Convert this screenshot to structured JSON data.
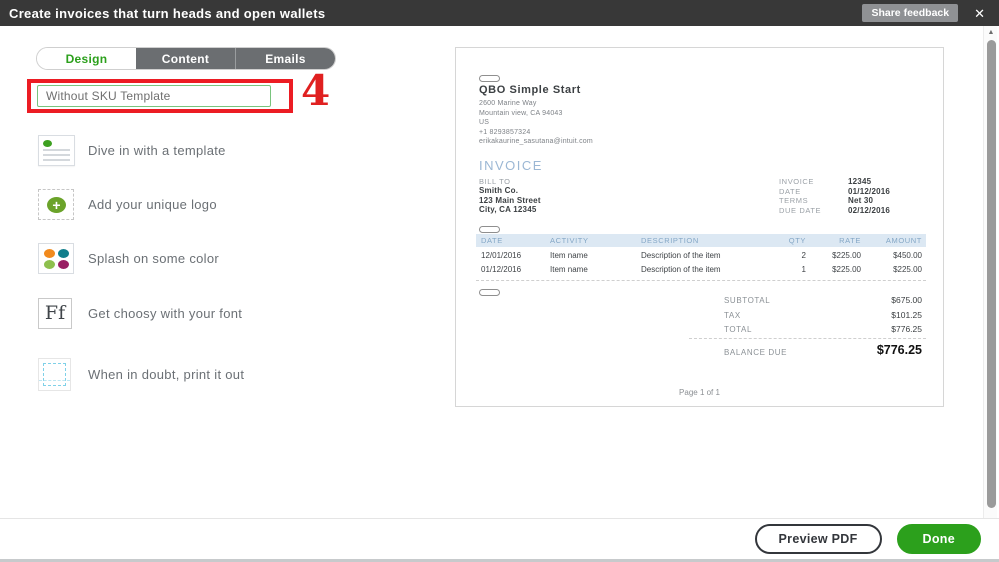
{
  "header": {
    "title": "Create invoices that turn heads and open wallets",
    "share_feedback_label": "Share feedback"
  },
  "icons": {
    "close": "✕",
    "plus": "+",
    "arrow_up": "▲",
    "arrow_down": "▼"
  },
  "tabs": [
    {
      "label": "Design",
      "active": true
    },
    {
      "label": "Content",
      "active": false
    },
    {
      "label": "Emails",
      "active": false
    }
  ],
  "design": {
    "template_name": "Without SKU Template",
    "annotation_number": "4"
  },
  "sidebar": {
    "items": [
      {
        "icon": "template-icon",
        "label": "Dive in with a template"
      },
      {
        "icon": "logo-upload-icon",
        "label": "Add your unique logo"
      },
      {
        "icon": "color-palette-icon",
        "label": "Splash on some color"
      },
      {
        "icon": "font-icon",
        "label": "Get choosy with your font",
        "icon_text": "Ff"
      },
      {
        "icon": "print-icon",
        "label": "When in doubt, print it out"
      }
    ]
  },
  "invoice": {
    "company_name": "QBO Simple Start",
    "company_address": [
      "2600 Marine Way",
      "Mountain view, CA 94043",
      "US",
      "+1 8293857324",
      "erikakaurine_sasutana@intuit.com"
    ],
    "title": "INVOICE",
    "bill_to": {
      "label": "BILL TO",
      "lines": [
        "Smith Co.",
        "123 Main Street",
        "City, CA 12345"
      ]
    },
    "meta": [
      {
        "label": "INVOICE",
        "value": "12345"
      },
      {
        "label": "DATE",
        "value": "01/12/2016"
      },
      {
        "label": "TERMS",
        "value": "Net 30"
      },
      {
        "label": "DUE DATE",
        "value": "02/12/2016"
      }
    ],
    "table": {
      "headers": [
        "DATE",
        "ACTIVITY",
        "DESCRIPTION",
        "QTY",
        "RATE",
        "AMOUNT"
      ],
      "rows": [
        [
          "12/01/2016",
          "Item name",
          "Description of the item",
          "2",
          "$225.00",
          "$450.00"
        ],
        [
          "01/12/2016",
          "Item name",
          "Description of the item",
          "1",
          "$225.00",
          "$225.00"
        ]
      ]
    },
    "totals": [
      {
        "label": "SUBTOTAL",
        "value": "$675.00"
      },
      {
        "label": "TAX",
        "value": "$101.25"
      },
      {
        "label": "TOTAL",
        "value": "$776.25"
      }
    ],
    "balance_due": {
      "label": "BALANCE DUE",
      "value": "$776.25"
    },
    "page_label": "Page 1 of 1"
  },
  "footer": {
    "preview_pdf_label": "Preview PDF",
    "done_label": "Done"
  },
  "colors": {
    "qb_green": "#2ca01c",
    "annotation_red": "#ec1c23",
    "header_bar": "#383838",
    "invoice_blue": "#9bb7d4",
    "table_header_bg": "#dce8f3",
    "palette_orange": "#f18a1d",
    "palette_teal": "#127f8c",
    "palette_green": "#8ec04e",
    "palette_magenta": "#991f63"
  }
}
